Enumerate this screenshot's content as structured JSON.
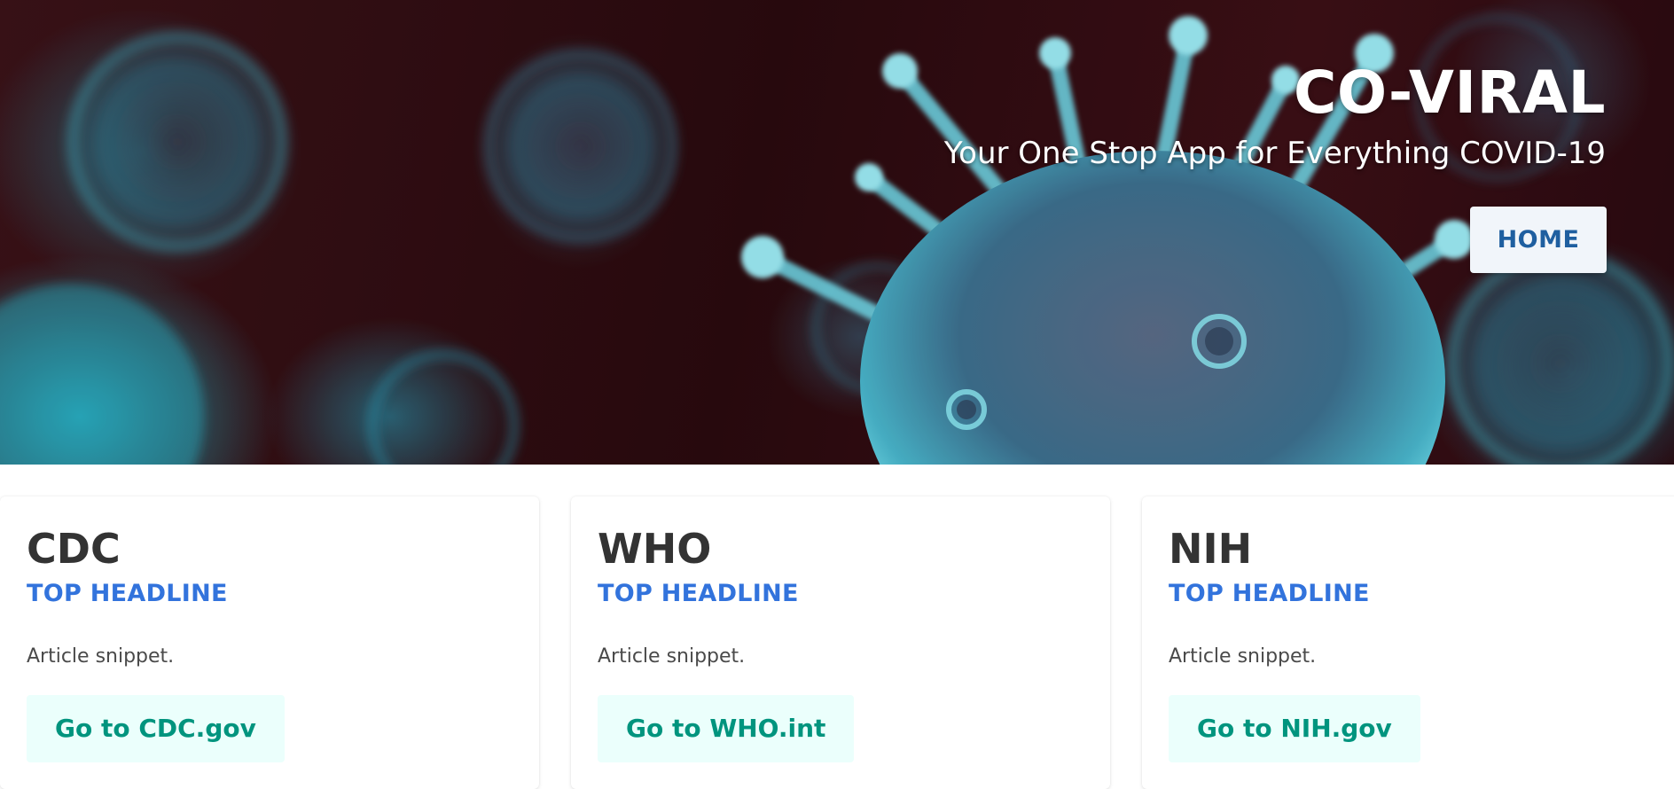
{
  "hero": {
    "title": "CO-VIRAL",
    "subtitle": "Your One Stop App for Everything COVID-19",
    "home_label": "HOME"
  },
  "cards": [
    {
      "title": "CDC",
      "subtitle": "TOP HEADLINE",
      "snippet": "Article snippet.",
      "link_label": "Go to CDC.gov"
    },
    {
      "title": "WHO",
      "subtitle": "TOP HEADLINE",
      "snippet": "Article snippet.",
      "link_label": "Go to WHO.int"
    },
    {
      "title": "NIH",
      "subtitle": "TOP HEADLINE",
      "snippet": "Article snippet.",
      "link_label": "Go to NIH.gov"
    }
  ],
  "colors": {
    "hero_background": "#2a0a0e",
    "virus_teal": "#4fc3d6",
    "headline_blue": "#3273dc",
    "link_green": "#00947e",
    "link_background": "#ebfffc",
    "home_text": "#1f5fa0"
  }
}
